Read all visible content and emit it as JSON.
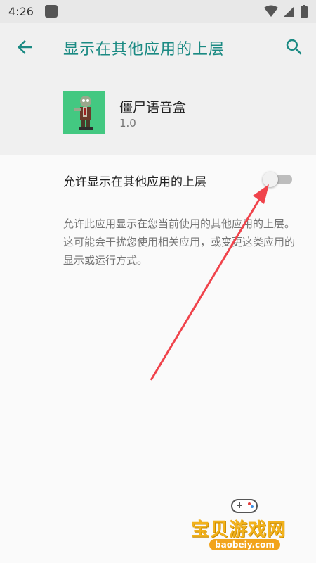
{
  "status_bar": {
    "time": "4:26"
  },
  "app_bar": {
    "title": "显示在其他应用的上层",
    "back_icon": "arrow-left-icon",
    "search_icon": "search-icon"
  },
  "app_info": {
    "name": "僵尸语音盒",
    "version": "1.0",
    "icon": "zombie-app-icon"
  },
  "setting": {
    "label": "允许显示在其他应用的上层",
    "enabled": false,
    "description": "允许此应用显示在您当前使用的其他应用的上层。这可能会干扰您使用相关应用，或变更这类应用的显示或运行方式。"
  },
  "watermark": {
    "text": "宝贝游戏网",
    "url": "baobeiy.com"
  },
  "colors": {
    "accent": "#1b8a83",
    "annotation_arrow": "#f0434b",
    "app_icon_bg": "#43c881"
  }
}
